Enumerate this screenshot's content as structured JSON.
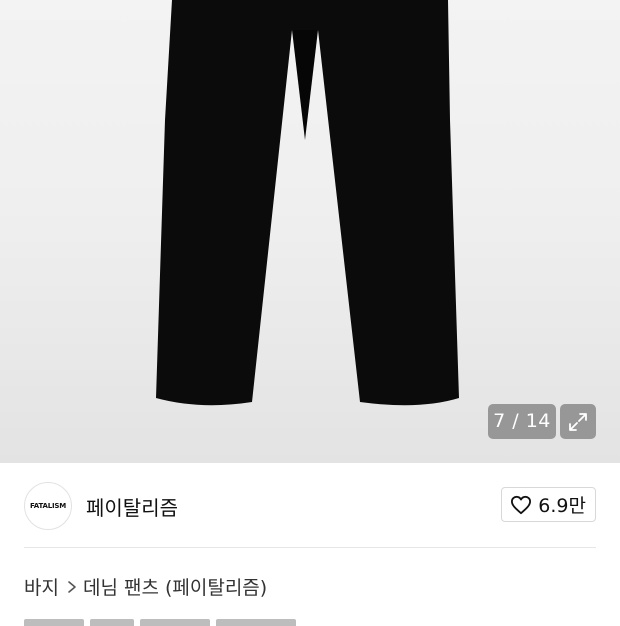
{
  "gallery": {
    "current": 7,
    "total": 14,
    "counter_text": "7 / 14",
    "expand_icon": "expand-icon"
  },
  "brand": {
    "logo_text": "FATALISM",
    "name": "페이탈리즘"
  },
  "like": {
    "icon": "heart-icon",
    "count": "6.9만"
  },
  "breadcrumb": {
    "items": [
      "바지",
      "데님 팬츠 (페이탈리즘)"
    ],
    "separator_icon": "chevron-right-icon"
  },
  "colors": {
    "pants": "#0b0b0b",
    "hero_bg": "#efefef",
    "overlay": "#787878"
  }
}
